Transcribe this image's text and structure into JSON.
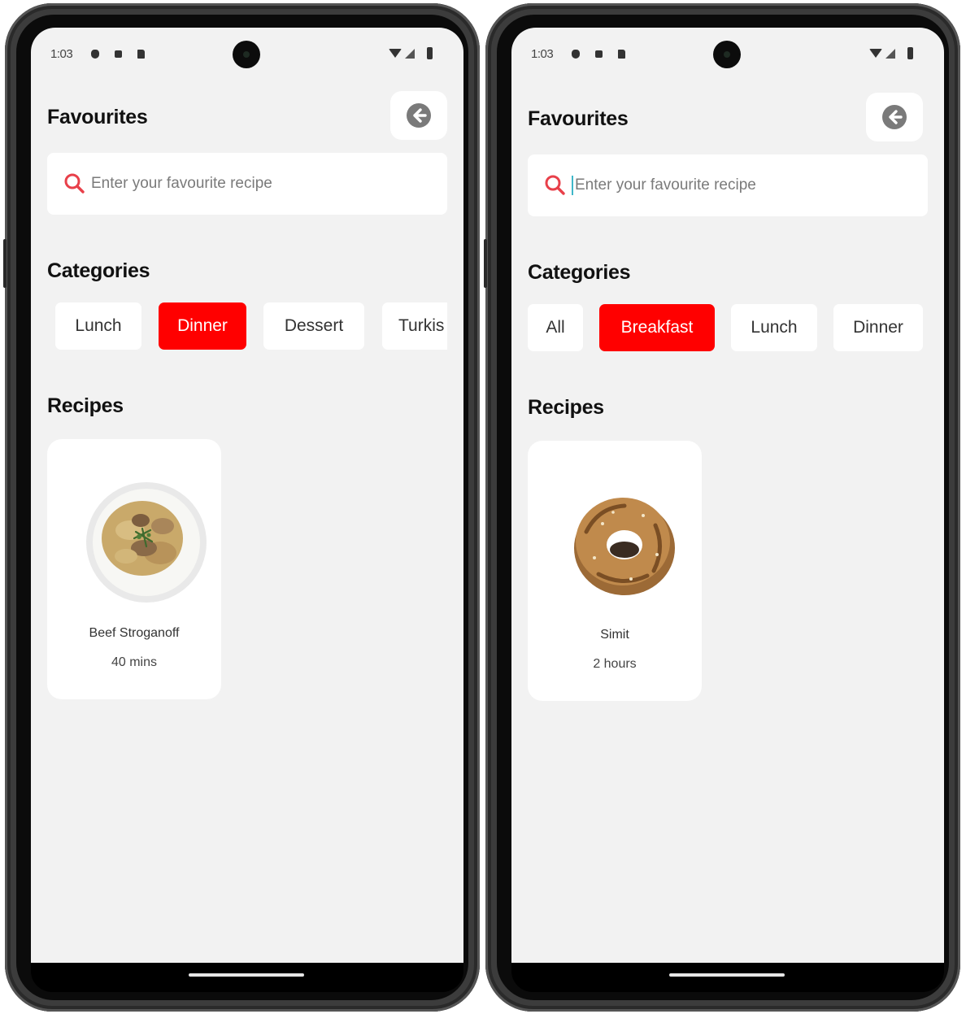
{
  "screens": [
    {
      "status_bar": {
        "time": "1:03"
      },
      "header": {
        "title": "Favourites",
        "back_icon": "arrow-left-circle-icon"
      },
      "search": {
        "placeholder": "Enter your favourite recipe",
        "value": "",
        "icon": "search-icon"
      },
      "categories": {
        "title": "Categories",
        "items": [
          {
            "label": "Lunch",
            "active": false
          },
          {
            "label": "Dinner",
            "active": true
          },
          {
            "label": "Dessert",
            "active": false
          },
          {
            "label": "Turkis",
            "active": false
          }
        ]
      },
      "recipes": {
        "title": "Recipes",
        "items": [
          {
            "name": "Beef Stroganoff",
            "time": "40 mins",
            "image": "beef-stroganoff-plate"
          }
        ]
      }
    },
    {
      "status_bar": {
        "time": "1:03"
      },
      "header": {
        "title": "Favourites",
        "back_icon": "arrow-left-circle-icon"
      },
      "search": {
        "placeholder": "Enter your favourite recipe",
        "value": "",
        "icon": "search-icon",
        "focused": true
      },
      "categories": {
        "title": "Categories",
        "items": [
          {
            "label": "All",
            "active": false
          },
          {
            "label": "Breakfast",
            "active": true
          },
          {
            "label": "Lunch",
            "active": false
          },
          {
            "label": "Dinner",
            "active": false
          }
        ]
      },
      "recipes": {
        "title": "Recipes",
        "items": [
          {
            "name": "Simit",
            "time": "2 hours",
            "image": "simit-bread"
          }
        ]
      }
    }
  ],
  "colors": {
    "accent": "#ff0000",
    "search_icon": "#e8404a",
    "screen_background": "#f2f2f2",
    "card_background": "#ffffff"
  }
}
